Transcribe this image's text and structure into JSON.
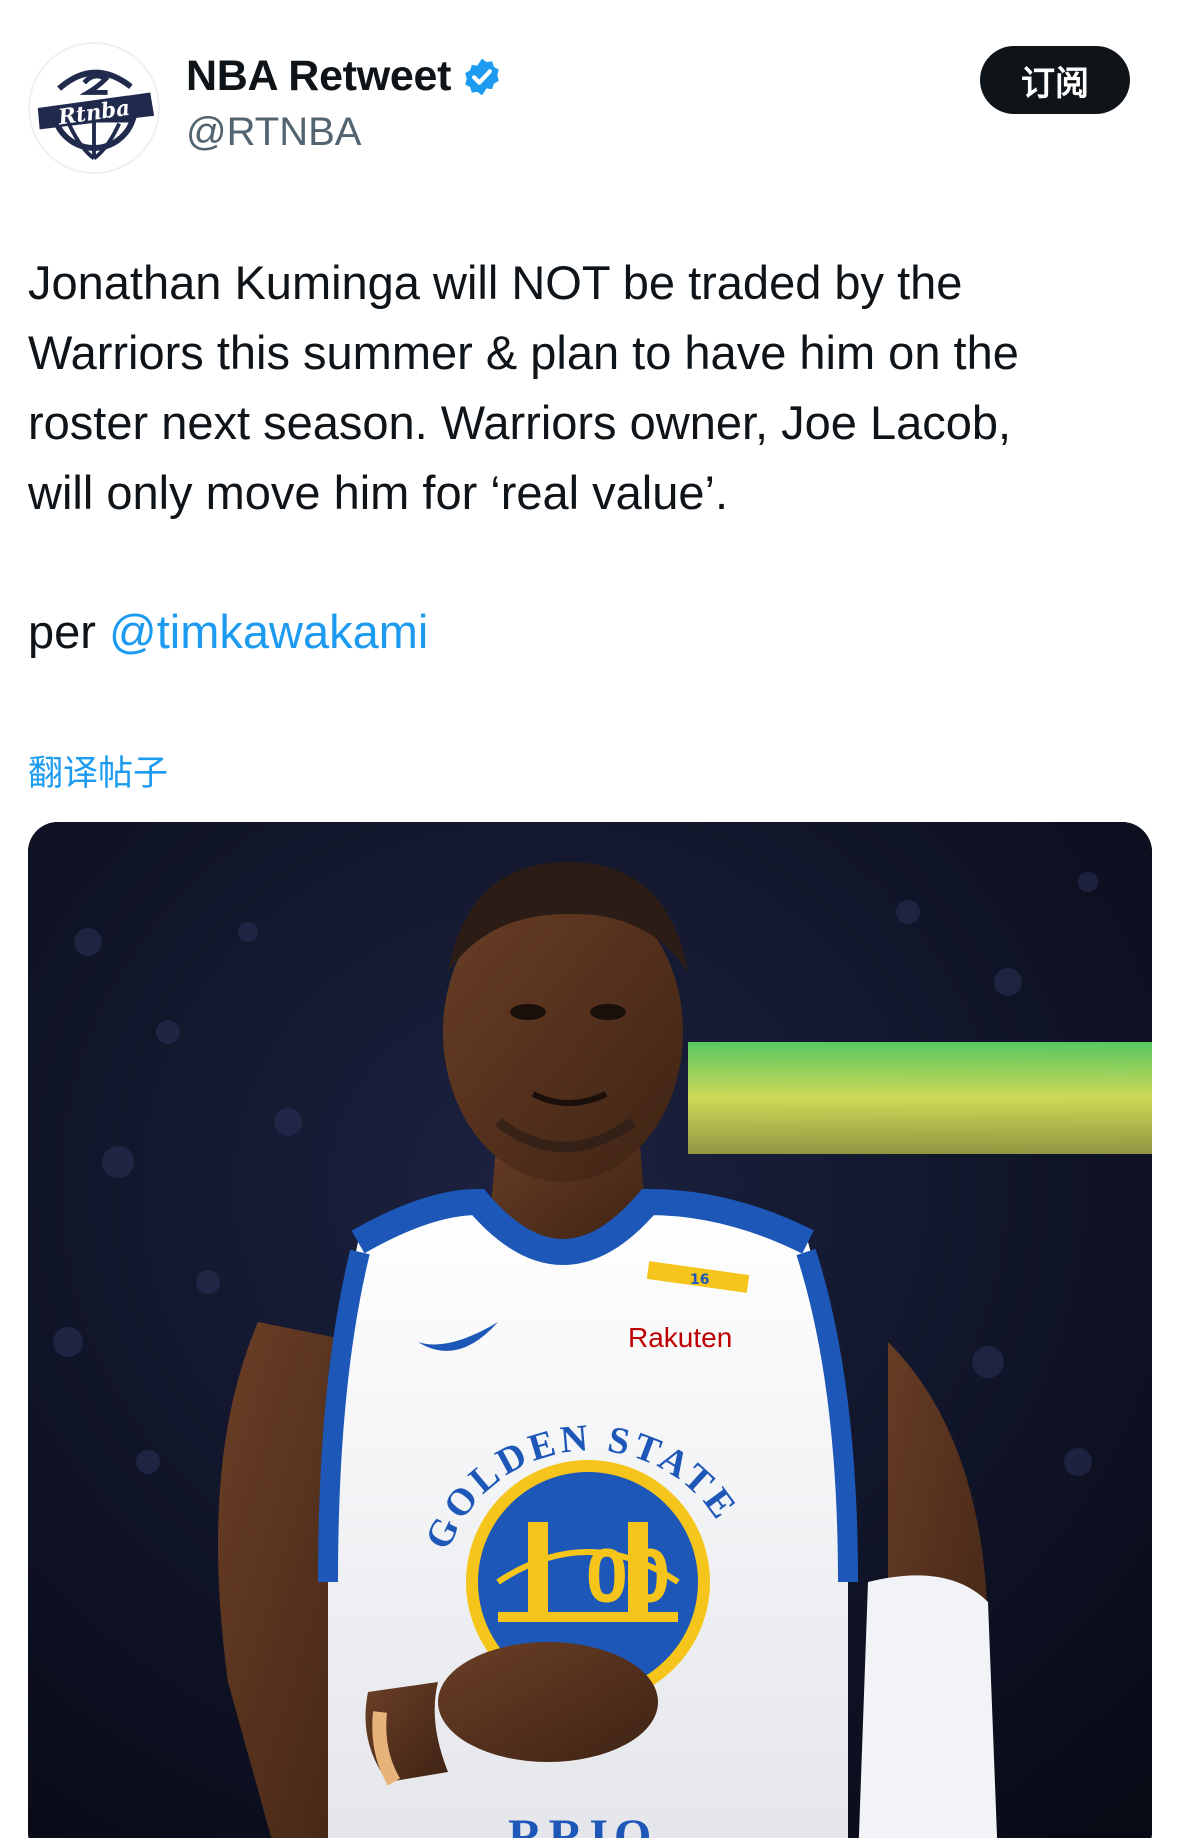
{
  "author": {
    "display_name": "NBA Retweet",
    "handle": "@RTNBA",
    "verified": true,
    "avatar_text": "Rtnba"
  },
  "subscribe_label": "订阅",
  "tweet": {
    "lines": [
      "Jonathan Kuminga will NOT be traded by the",
      "Warriors this summer & plan to have him on the",
      "roster next season. Warriors owner, Joe Lacob,",
      "will only move him for ‘real value’."
    ],
    "credit_prefix": "per",
    "mention": "@timkawakami"
  },
  "translate_label": "翻译帖子",
  "photo": {
    "jersey_sponsor": "Rakuten",
    "jersey_arc_text": "GOLDEN STATE",
    "jersey_number": "00",
    "jersey_bottom_text": "RRIO",
    "strap_number": "16"
  },
  "colors": {
    "text": "#0f1419",
    "secondary": "#536471",
    "link": "#1d9bf0",
    "button_bg": "#0f1419",
    "warriors_blue": "#1d57b8",
    "warriors_gold": "#f5c51b"
  }
}
